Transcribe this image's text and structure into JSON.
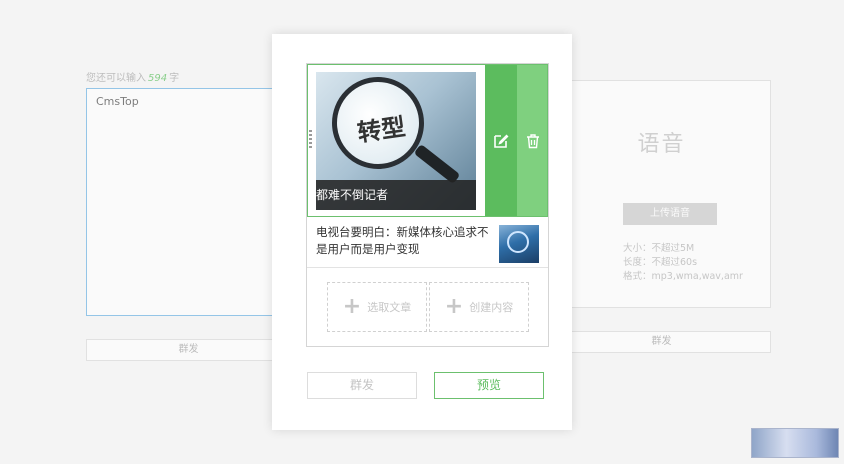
{
  "left_editor": {
    "remain_prefix": "您还可以输入",
    "remain_count": "594",
    "remain_suffix": "字",
    "content": "CmsTop",
    "send_label": "群发"
  },
  "voice_panel": {
    "title": "语音",
    "upload_label": "上传语音",
    "spec_lines": [
      "大小：不超过5M",
      "长度：不超过60s",
      "格式：mp3,wma,wav,amr"
    ],
    "send_label": "群发"
  },
  "modal": {
    "cover_article": {
      "image_text": "转型",
      "caption": "都难不倒记者",
      "edit_icon": "edit-icon",
      "delete_icon": "trash-icon"
    },
    "sub_article": {
      "title": "电视台要明白：新媒体核心追求不是用户而是用户变现"
    },
    "add_buttons": {
      "select_label": "选取文章",
      "create_label": "创建内容"
    },
    "send_label": "群发",
    "preview_label": "预览"
  },
  "colors": {
    "accent_green": "#5cbc5e",
    "light_green": "#7fd07f",
    "editor_border": "#5aa9e0"
  }
}
